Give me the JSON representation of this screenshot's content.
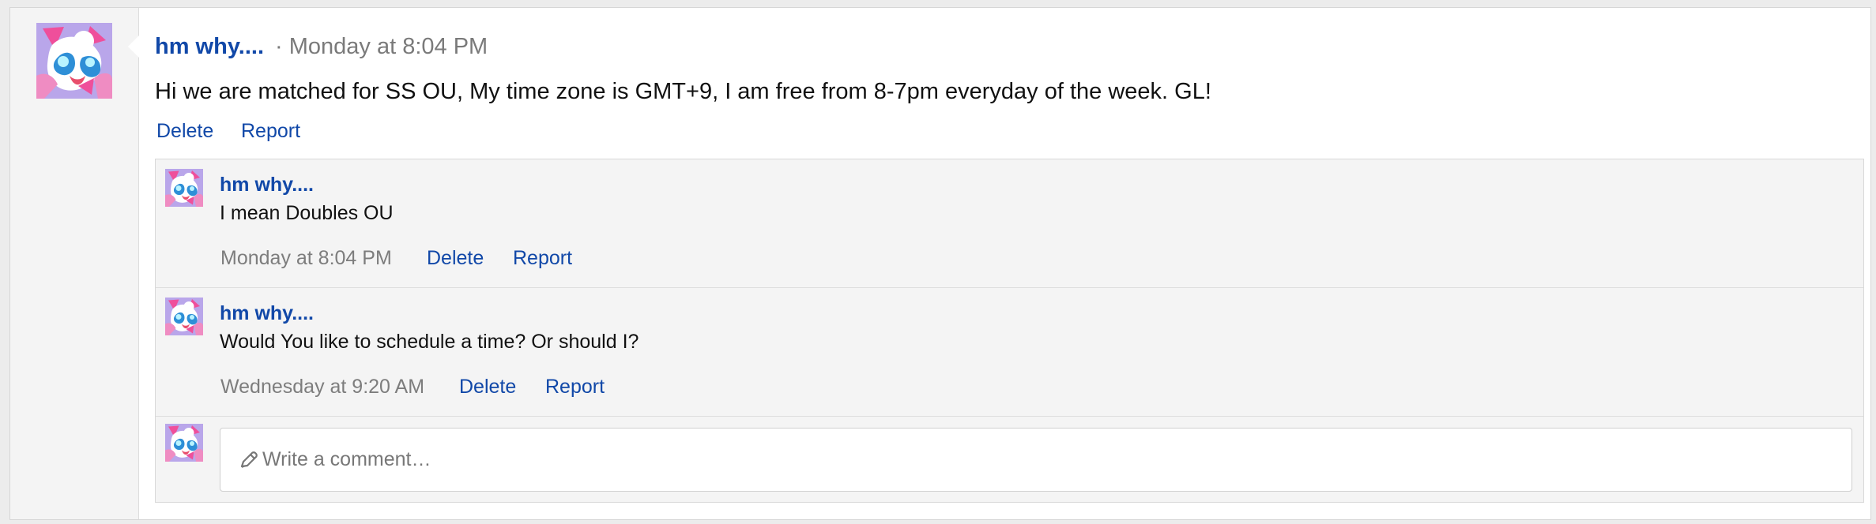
{
  "post": {
    "author": "hm why....",
    "separator": "·",
    "time": "Monday at 8:04 PM",
    "message": "Hi we are matched for SS OU, My time zone is GMT+9, I am free from 8-7pm everyday of the week. GL!",
    "actions": {
      "delete": "Delete",
      "report": "Report"
    },
    "avatar_icon": "pink-creature-avatar-icon"
  },
  "comments": [
    {
      "author": "hm why....",
      "message": "I mean Doubles OU",
      "time": "Monday at 8:04 PM",
      "delete": "Delete",
      "report": "Report"
    },
    {
      "author": "hm why....",
      "message": "Would You like to schedule a time? Or should I?",
      "time": "Wednesday at 9:20 AM",
      "delete": "Delete",
      "report": "Report"
    }
  ],
  "composer": {
    "placeholder": "Write a comment…",
    "icon": "pencil-icon"
  },
  "colors": {
    "link": "#1148a8",
    "muted": "#7a7a7a",
    "avatar_bg": "#bba7ea",
    "avatar_pink": "#ef4f9b"
  }
}
